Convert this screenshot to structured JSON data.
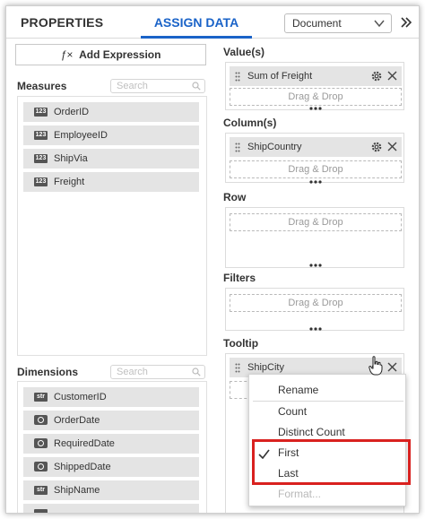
{
  "header": {
    "tab_properties": "PROPERTIES",
    "tab_assign_data": "ASSIGN DATA",
    "document_select": "Document",
    "accent_color": "#1a63c8"
  },
  "left": {
    "add_expression": "Add Expression",
    "fx_symbol": "ƒ×",
    "measures": {
      "title": "Measures",
      "search_placeholder": "Search",
      "fields": [
        {
          "badge": "123",
          "label": "OrderID"
        },
        {
          "badge": "123",
          "label": "EmployeeID"
        },
        {
          "badge": "123",
          "label": "ShipVia"
        },
        {
          "badge": "123",
          "label": "Freight"
        }
      ]
    },
    "dimensions": {
      "title": "Dimensions",
      "search_placeholder": "Search",
      "fields": [
        {
          "badge": "str",
          "label": "CustomerID"
        },
        {
          "badge": "date",
          "label": "OrderDate"
        },
        {
          "badge": "date",
          "label": "RequiredDate"
        },
        {
          "badge": "date",
          "label": "ShippedDate"
        },
        {
          "badge": "str",
          "label": "ShipName"
        }
      ]
    }
  },
  "right": {
    "values": {
      "title": "Value(s)",
      "pill": "Sum of Freight",
      "drop": "Drag & Drop"
    },
    "columns": {
      "title": "Column(s)",
      "pill": "ShipCountry",
      "drop": "Drag & Drop"
    },
    "row": {
      "title": "Row",
      "drop": "Drag & Drop"
    },
    "filters": {
      "title": "Filters",
      "drop": "Drag & Drop"
    },
    "tooltip": {
      "title": "Tooltip",
      "pill": "ShipCity"
    }
  },
  "menu": {
    "items": [
      "Rename",
      "Count",
      "Distinct Count",
      "First",
      "Last",
      "Format..."
    ],
    "checked": "First",
    "highlight_color": "#d9211f"
  }
}
